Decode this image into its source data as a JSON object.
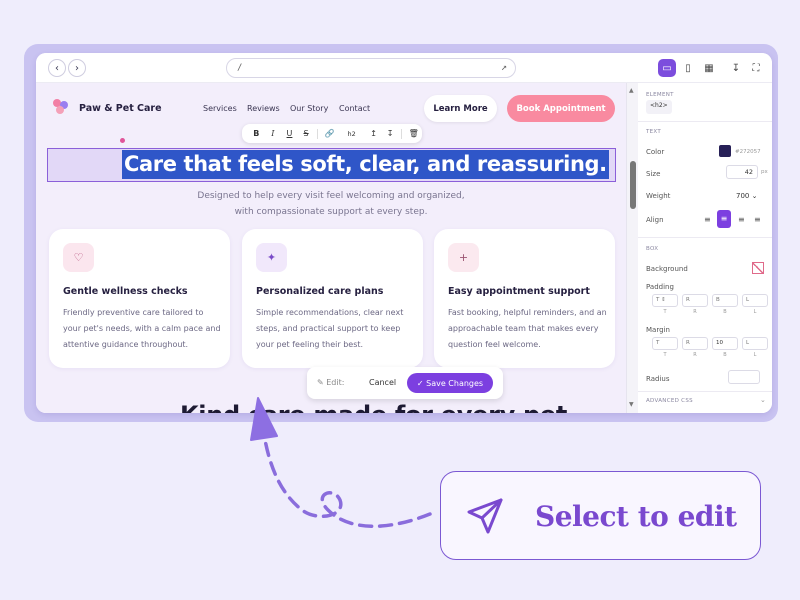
{
  "browser": {
    "url": "/"
  },
  "site": {
    "brand": "Paw & Pet Care",
    "nav": [
      "Services",
      "Reviews",
      "Our Story",
      "Contact"
    ],
    "learn_more": "Learn More",
    "book": "Book Appointment",
    "headline": "Care that feels soft, clear, and reassuring.",
    "subtitle": "Designed to help every visit feel welcoming and organized, with compassionate support at every step.",
    "next_heading": "Kind care made for every pet",
    "cards": [
      {
        "icon": "heart-icon",
        "title": "Gentle wellness checks",
        "text": "Friendly preventive care tailored to your pet's needs, with a calm pace and attentive guidance throughout."
      },
      {
        "icon": "sparkle-icon",
        "title": "Personalized care plans",
        "text": "Simple recommendations, clear next steps, and practical support to keep your pet feeling their best."
      },
      {
        "icon": "plus-icon",
        "title": "Easy appointment support",
        "text": "Fast booking, helpful reminders, and an approachable team that makes every question feel welcome."
      }
    ]
  },
  "format_toolbar": {
    "heading_level": "h2"
  },
  "edit_bar": {
    "label": "Edit:",
    "cancel": "Cancel",
    "save": "Save Changes"
  },
  "panel": {
    "element_header": "ELEMENT",
    "element_tag": "<h2>",
    "text_header": "TEXT",
    "color_label": "Color",
    "color_value": "#272057",
    "size_label": "Size",
    "size_value": "42",
    "size_unit": "px",
    "weight_label": "Weight",
    "weight_value": "700",
    "align_label": "Align",
    "box_header": "BOX",
    "background_label": "Background",
    "padding_label": "Padding",
    "padding_values": [
      "T",
      "R",
      "B",
      "L"
    ],
    "padding_sides": [
      "T",
      "R",
      "B",
      "L"
    ],
    "margin_label": "Margin",
    "margin_values": [
      "T",
      "R",
      "10",
      "L"
    ],
    "margin_sides": [
      "T",
      "R",
      "B",
      "L"
    ],
    "radius_label": "Radius",
    "advanced": "ADVANCED CSS"
  },
  "callout": {
    "text": "Select to edit"
  },
  "colors": {
    "accent": "#7c3fe0",
    "book": "#f98aa0",
    "selection": "#2f56c8",
    "heading": "#272057"
  }
}
